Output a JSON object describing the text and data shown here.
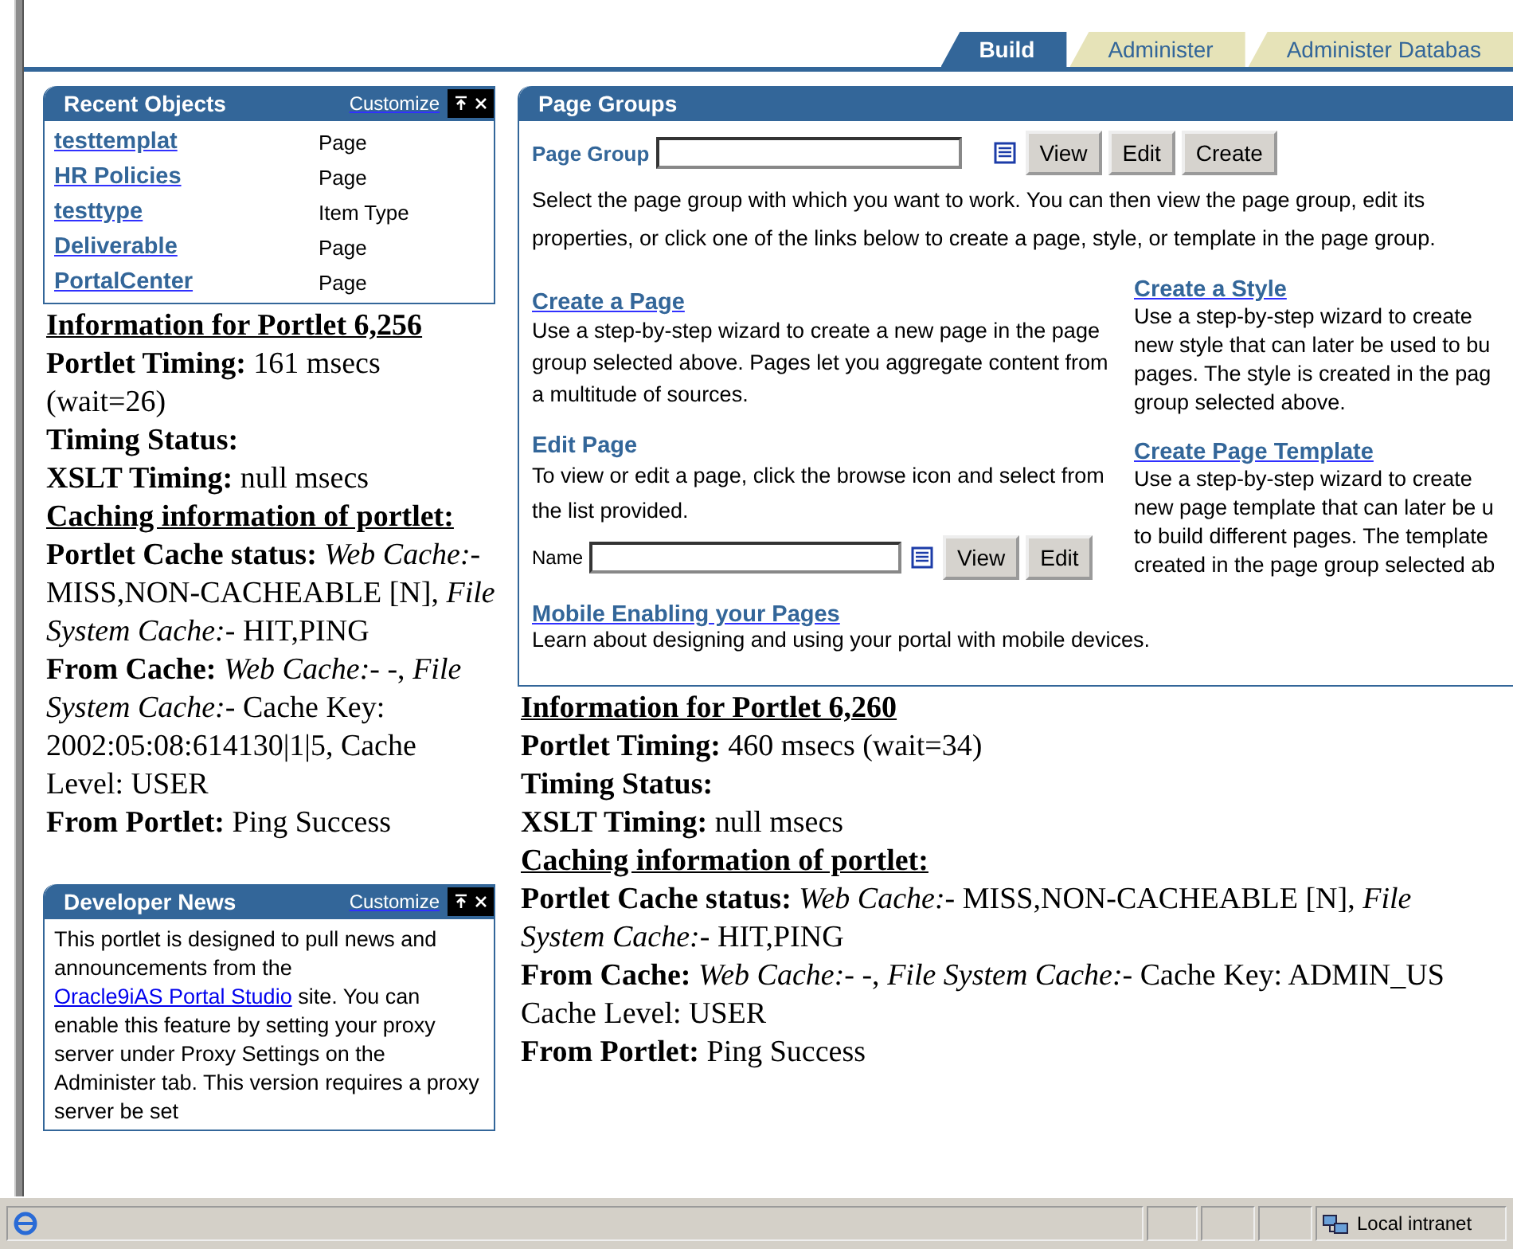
{
  "tabs": [
    {
      "label": "Build",
      "selected": true
    },
    {
      "label": "Administer",
      "selected": false
    },
    {
      "label": "Administer Databas",
      "selected": false
    }
  ],
  "recent_objects": {
    "title": "Recent Objects",
    "customize": "Customize",
    "rows": [
      {
        "name": "testtemplat",
        "type": "Page"
      },
      {
        "name": "HR Policies",
        "type": "Page"
      },
      {
        "name": "testtype",
        "type": "Item Type"
      },
      {
        "name": "Deliverable",
        "type": "Page"
      },
      {
        "name": "PortalCenter",
        "type": "Page"
      }
    ]
  },
  "portlet_info_left": {
    "heading": "Information for Portlet 6,256",
    "lines": [
      {
        "kind": "text",
        "text": "**Portlet Timing:** 161 msecs (wait=26)"
      },
      {
        "kind": "text",
        "text": "**Timing Status:**"
      },
      {
        "kind": "text",
        "text": "**XSLT Timing:** null msecs"
      },
      {
        "kind": "heading",
        "text": "Caching information of portlet:"
      },
      {
        "kind": "text",
        "text": "**Portlet Cache status:** *Web Cache:*- MISS,NON-CACHEABLE [N], *File System Cache:*- HIT,PING"
      },
      {
        "kind": "text",
        "text": "**From Cache:** *Web Cache:*- -, *File System Cache:*- Cache Key: 2002:05:08:614130|1|5, Cache Level: USER"
      },
      {
        "kind": "text",
        "text": "**From Portlet:** Ping Success"
      }
    ]
  },
  "developer_news": {
    "title": "Developer News",
    "customize": "Customize",
    "text_before": "This portlet is designed to pull news and announcements from the",
    "link": "Oracle9iAS Portal Studio",
    "text_after": "site. You can enable this feature by setting your proxy server under Proxy Settings on the Administer tab. This version requires a proxy server be set"
  },
  "page_groups": {
    "title": "Page Groups",
    "field_label": "Page Group",
    "buttons": [
      "View",
      "Edit",
      "Create"
    ],
    "description": "Select the page group with which you want to work. You can then view the page group, edit its properties, or click one of the links below to create a page, style, or template in the page group.",
    "create_page": {
      "link": "Create a Page",
      "description": "Use a step-by-step wizard to create a new page in the page group selected above. Pages let you aggregate content from a multitude of sources."
    },
    "edit_page": {
      "heading": "Edit Page",
      "description": "To view or edit a page, click the browse icon and select from the list provided.",
      "field_label": "Name",
      "buttons": [
        "View",
        "Edit"
      ]
    },
    "mobile": {
      "link": "Mobile Enabling your Pages",
      "description": "Learn about designing and using your portal with mobile devices."
    },
    "create_style": {
      "link": "Create a Style",
      "lines": [
        "Use a step-by-step wizard to create",
        "new style that can later be used to bu",
        "pages. The style is created in the pag",
        "group selected above."
      ]
    },
    "create_template": {
      "link": "Create Page Template",
      "lines": [
        "Use a step-by-step wizard to create",
        "new page template that can later be u",
        "to build different pages. The template",
        "created in the page group selected ab"
      ]
    }
  },
  "portlet_info_right": {
    "heading": "Information for Portlet 6,260",
    "lines": [
      {
        "kind": "text",
        "text": "**Portlet Timing:** 460 msecs (wait=34)"
      },
      {
        "kind": "text",
        "text": "**Timing Status:**"
      },
      {
        "kind": "text",
        "text": "**XSLT Timing:** null msecs"
      },
      {
        "kind": "heading",
        "text": "Caching information of portlet:"
      },
      {
        "kind": "text",
        "text": "**Portlet Cache status:** *Web Cache:*- MISS,NON-CACHEABLE [N], *File*"
      },
      {
        "kind": "text",
        "text": "*System Cache:*- HIT,PING"
      },
      {
        "kind": "text",
        "text": "**From Cache:** *Web Cache:*- -, *File System Cache:*- Cache Key: ADMIN_US"
      },
      {
        "kind": "text",
        "text": "Cache Level: USER"
      },
      {
        "kind": "text",
        "text": "**From Portlet:** Ping Success"
      }
    ]
  },
  "status_bar": {
    "zone": "Local intranet"
  }
}
